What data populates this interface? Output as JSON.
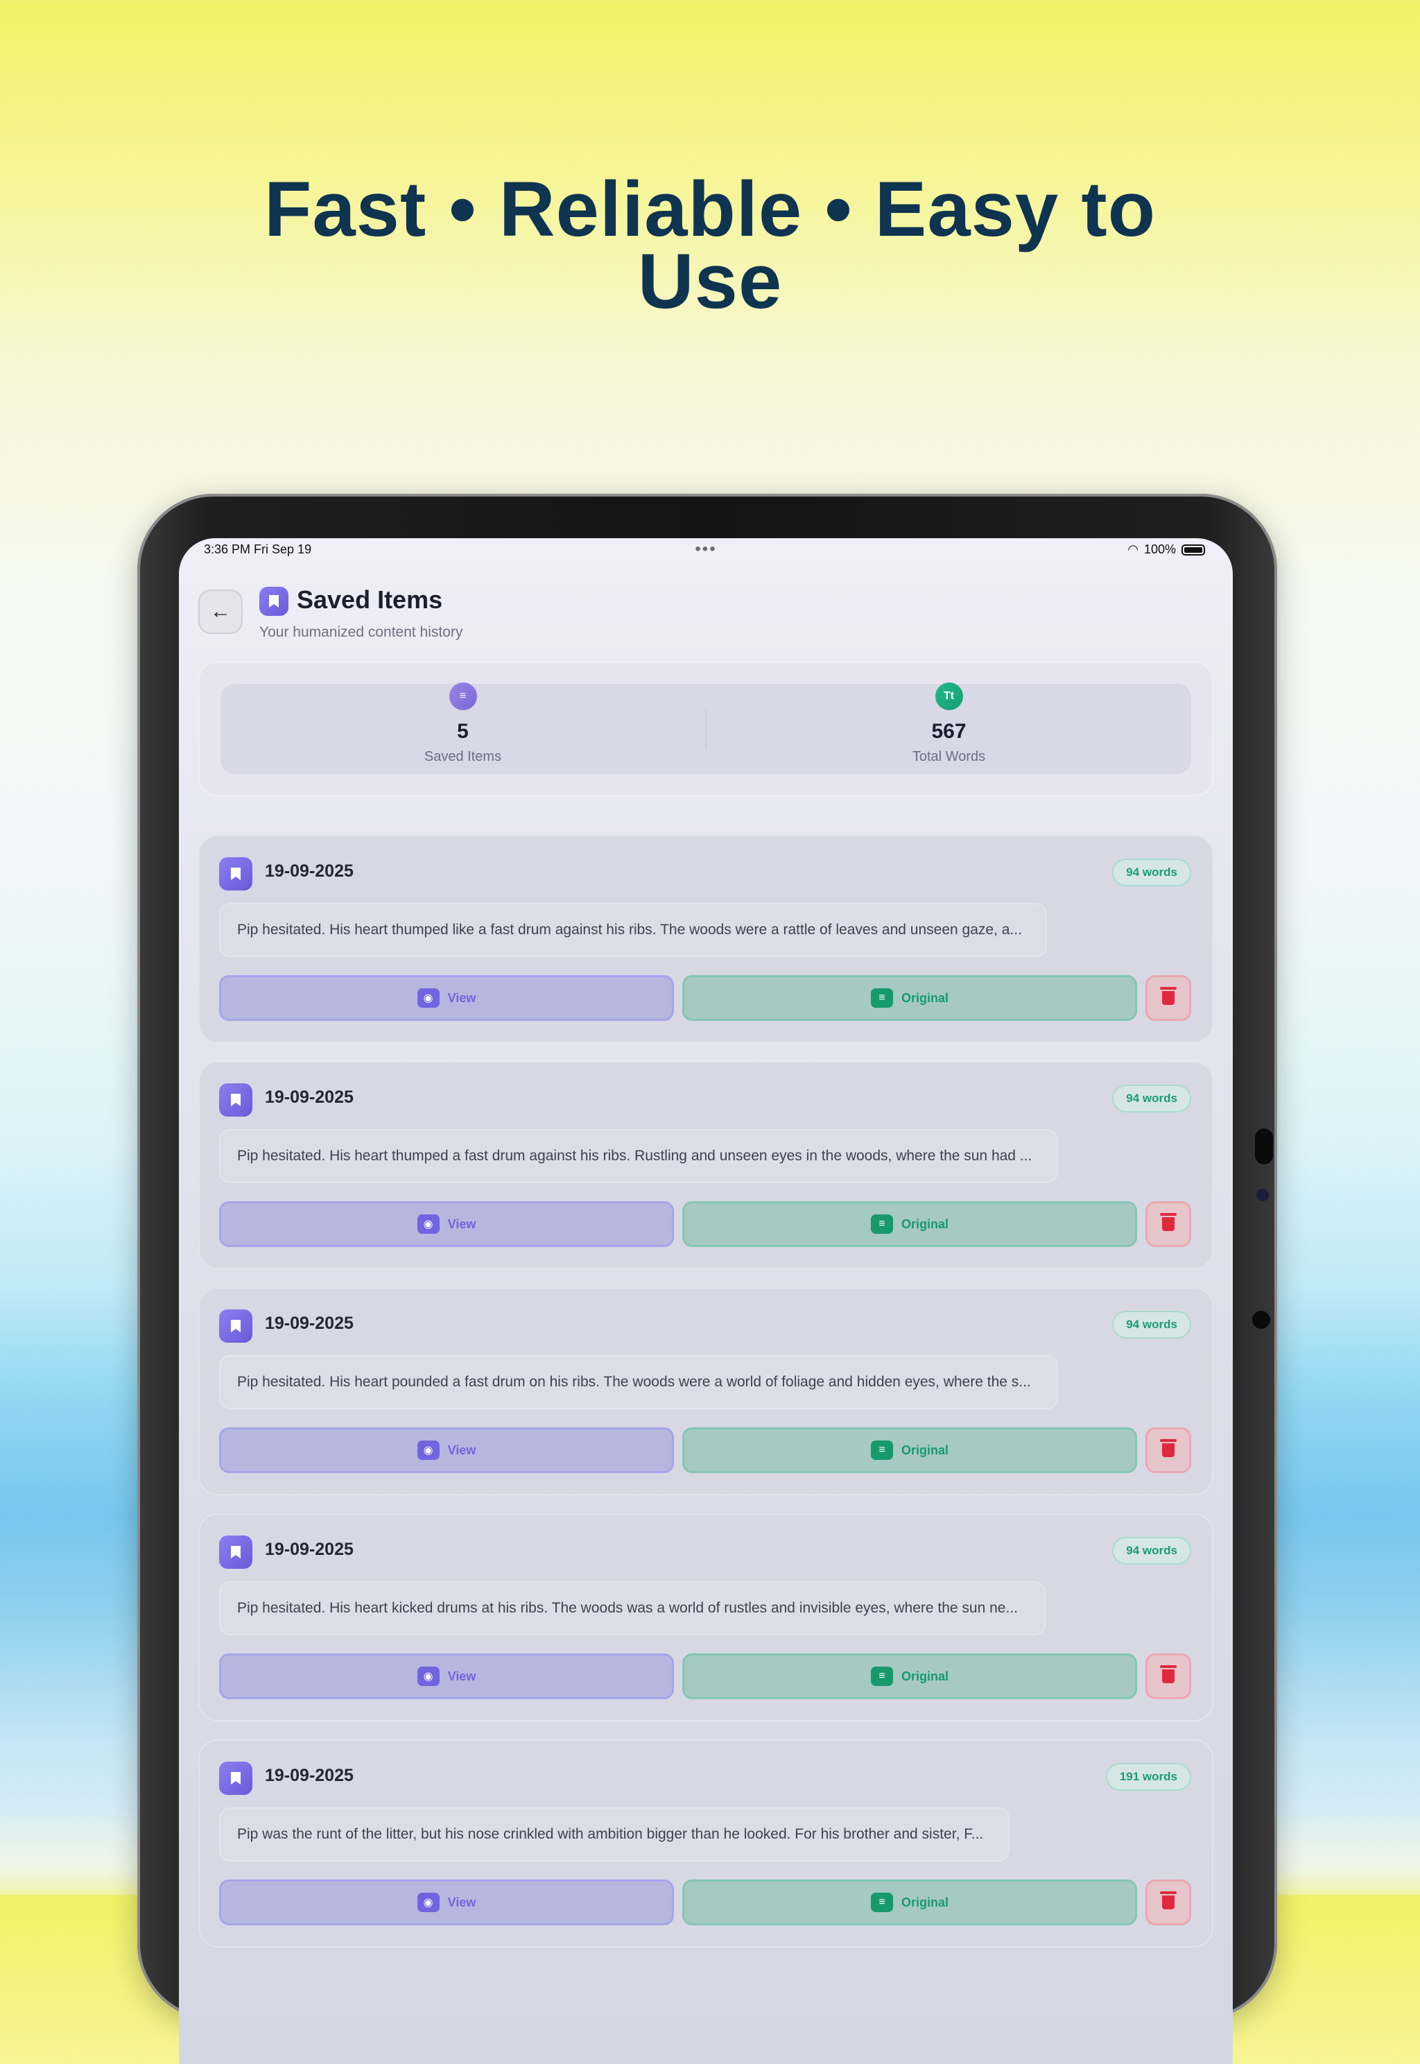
{
  "headline": {
    "line1": "Fast • Reliable • Easy to",
    "line2": "Use"
  },
  "status_bar": {
    "time": "3:36 PM   Fri Sep 19",
    "dots": "•••",
    "battery": "100%"
  },
  "header": {
    "title": "Saved Items",
    "subtitle": "Your humanized content history"
  },
  "stats": [
    {
      "value": "5",
      "label": "Saved Items",
      "icon": "document-icon"
    },
    {
      "value": "567",
      "label": "Total Words",
      "icon": "text-size-icon",
      "icon_text": "Tt"
    }
  ],
  "buttons": {
    "view": "View",
    "original": "Original"
  },
  "items": [
    {
      "date": "19-09-2025",
      "words": "94 words",
      "preview": "Pip hesitated. His heart thumped like a fast drum against his ribs. The woods were a rattle of leaves and unseen gaze, a..."
    },
    {
      "date": "19-09-2025",
      "words": "94 words",
      "preview": "Pip hesitated. His heart thumped a fast drum against his ribs. Rustling and unseen eyes in the woods, where the sun had ..."
    },
    {
      "date": "19-09-2025",
      "words": "94 words",
      "preview": "Pip hesitated. His heart pounded a fast drum on his ribs. The woods were a world of foliage and hidden eyes, where the s..."
    },
    {
      "date": "19-09-2025",
      "words": "94 words",
      "preview": "Pip hesitated. His heart kicked drums at his ribs. The woods was a world of rustles and invisible eyes, where the sun ne..."
    },
    {
      "date": "19-09-2025",
      "words": "191 words",
      "preview": "Pip was the runt of the litter, but his nose crinkled with ambition bigger than he looked. For his brother and sister, F..."
    }
  ],
  "colors": {
    "headline": "#0f3450",
    "accent_purple": "#6f65df",
    "accent_green": "#169a6c",
    "danger": "#e0293f"
  }
}
